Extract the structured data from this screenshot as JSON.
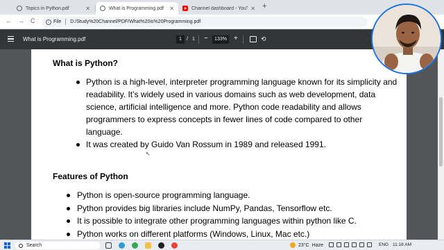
{
  "tabs": [
    {
      "title": "Topics in Python.pdf",
      "active": false,
      "favicon": "globe-icon"
    },
    {
      "title": "What is Programming.pdf",
      "active": true,
      "favicon": "globe-icon"
    },
    {
      "title": "Channel dashboard - YouTube",
      "active": false,
      "favicon": "youtube-icon"
    }
  ],
  "browser": {
    "new_tab": "+",
    "back": "←",
    "forward": "→",
    "reload": "C",
    "scheme_label": "File",
    "url": "D:/Study%20Channel/PDF/What%20is%20Programming.pdf"
  },
  "pdf_toolbar": {
    "title": "What is Programming.pdf",
    "page_current": "1",
    "page_separator": "/",
    "page_total": "1",
    "zoom": "133%",
    "zoom_out": "−",
    "zoom_in": "+"
  },
  "document": {
    "heading_what": "What is Python?",
    "what_items": [
      "Python is a high-level, interpreter programming language known for its simplicity and readability. It’s widely used in various domains such as web development, data science, artificial intelligence and more. Python code readability and allows programmers to express concepts in fewer lines of code compared to other language.",
      "It was created by Guido Van Rossum in 1989 and released 1991."
    ],
    "heading_features": "Features of Python",
    "feature_items": [
      "Python is open-source programming language.",
      "Python provides big libraries include NumPy, Pandas, Tensorflow etc.",
      "It is possible to integrate other programming languages within python like C.",
      "Python works on different platforms (Windows, Linux, Mac etc.)"
    ]
  },
  "taskbar": {
    "search_placeholder": "Search",
    "weather_temp": "23°C",
    "weather_desc": "Haze",
    "language": "ENG",
    "time": "11:18 AM"
  },
  "colors": {
    "pdf_toolbar_bg": "#323639",
    "viewer_bg": "#525659",
    "tab_strip_bg": "#dfe3e8",
    "accent": "#1a73e8"
  }
}
